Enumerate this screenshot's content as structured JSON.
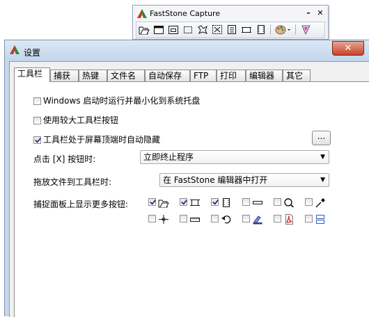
{
  "toolbar_window": {
    "title": "FastStone Capture",
    "minimize": "–",
    "close": "✕",
    "tools": [
      "open-icon",
      "capture-window-icon",
      "capture-object-icon",
      "capture-region-icon",
      "capture-freehand-icon",
      "capture-fullscreen-icon",
      "capture-scrolling-icon",
      "capture-fixed-region-icon",
      "screen-recorder-icon",
      "output-palette-icon",
      "settings-menu-icon"
    ]
  },
  "dialog": {
    "title": "设置",
    "close": "✕",
    "tabs": [
      "工具栏",
      "捕获",
      "热键",
      "文件名",
      "自动保存",
      "FTP",
      "打印",
      "编辑器",
      "其它"
    ],
    "active_tab": "工具栏",
    "options": {
      "startup": {
        "label": "Windows 启动时运行并最小化到系统托盘",
        "checked": false
      },
      "larger_buttons": {
        "label": "使用较大工具栏按钮",
        "checked": false
      },
      "auto_hide": {
        "label": "工具栏处于屏幕顶端时自动隐藏",
        "checked": true
      },
      "more_button": "...",
      "close_click_label": "点击 [X] 按钮时:",
      "close_click_value": "立即终止程序",
      "drag_file_label": "拖放文件到工具栏时:",
      "drag_file_value": "在 FastStone 编辑器中打开",
      "more_buttons_label": "捕捉面板上显示更多按钮:"
    },
    "panel_buttons": [
      {
        "icon": "open-icon",
        "checked": true
      },
      {
        "icon": "capture-region-icon",
        "checked": true
      },
      {
        "icon": "film-strip-icon",
        "checked": true
      },
      {
        "icon": "fixed-rectangle-icon",
        "checked": false
      },
      {
        "icon": "magnifier-icon",
        "checked": false
      },
      {
        "icon": "color-picker-icon",
        "checked": false
      },
      {
        "icon": "crosshair-icon",
        "checked": false
      },
      {
        "icon": "ruler-icon",
        "checked": false
      },
      {
        "icon": "undo-arrow-icon",
        "checked": false
      },
      {
        "icon": "image-editor-icon",
        "checked": false
      },
      {
        "icon": "pdf-icon",
        "checked": false
      },
      {
        "icon": "layout-icon",
        "checked": false
      }
    ]
  }
}
